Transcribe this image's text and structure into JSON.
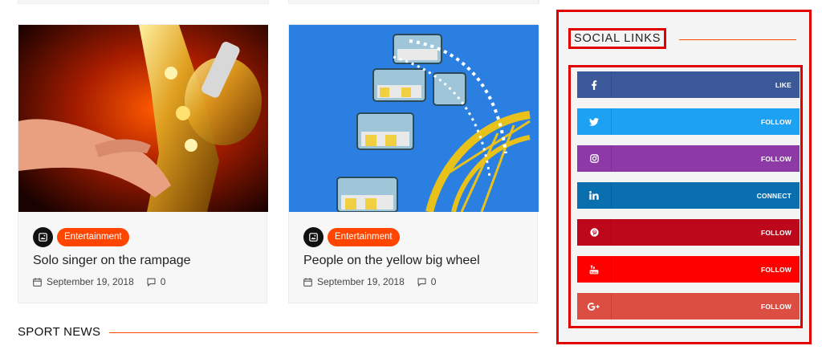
{
  "cards": [
    {
      "category": "Entertainment",
      "title": "Solo singer on the rampage",
      "date": "September 19, 2018",
      "comments": "0",
      "image_icon": "saxophone-photo"
    },
    {
      "category": "Entertainment",
      "title": "People on the yellow big wheel",
      "date": "September 19, 2018",
      "comments": "0",
      "image_icon": "ferris-wheel-photo"
    }
  ],
  "section": {
    "title": "SPORT NEWS"
  },
  "sidebar": {
    "title": "SOCIAL LINKS",
    "links": [
      {
        "network": "facebook",
        "icon": "facebook-icon",
        "label": "LIKE",
        "color": "#3b5998"
      },
      {
        "network": "twitter",
        "icon": "twitter-icon",
        "label": "FOLLOW",
        "color": "#1da1f2"
      },
      {
        "network": "instagram",
        "icon": "instagram-icon",
        "label": "FOLLOW",
        "color": "#8e3aa6"
      },
      {
        "network": "linkedin",
        "icon": "linkedin-icon",
        "label": "CONNECT",
        "color": "#0a6fae"
      },
      {
        "network": "pinterest",
        "icon": "pinterest-icon",
        "label": "FOLLOW",
        "color": "#bd081c"
      },
      {
        "network": "youtube",
        "icon": "youtube-icon",
        "label": "FOLLOW",
        "color": "#ff0000"
      },
      {
        "network": "google-plus",
        "icon": "google-plus-icon",
        "label": "FOLLOW",
        "color": "#dc4e41"
      }
    ]
  },
  "colors": {
    "accent": "#ff4500",
    "highlight": "#e00000"
  }
}
